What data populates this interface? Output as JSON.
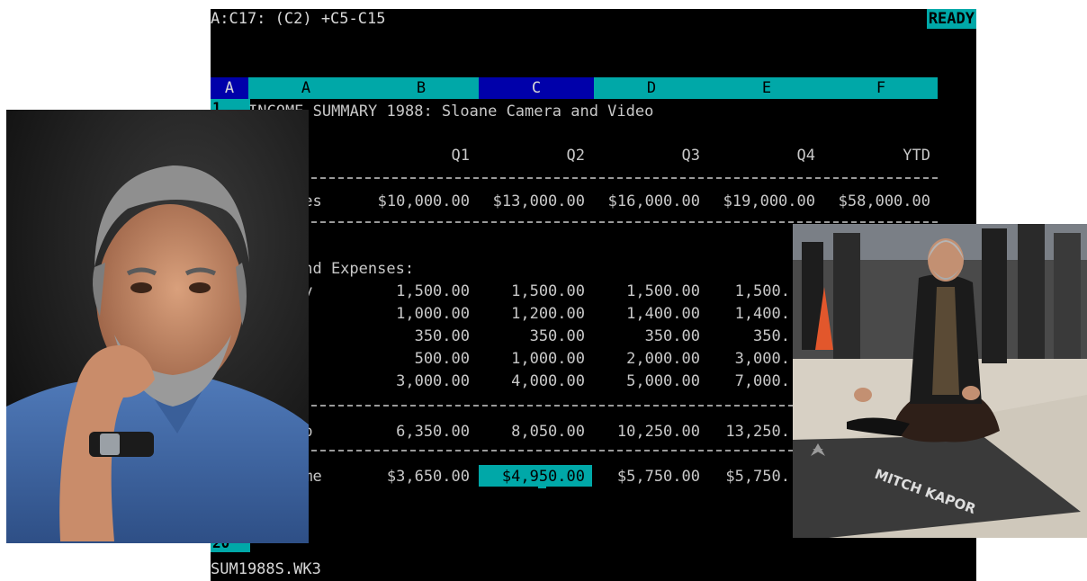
{
  "status": {
    "cell_ref": "A:C17: (C2) +C5-C15",
    "mode": "READY"
  },
  "col_headers": {
    "corner": "A",
    "a": "A",
    "b": "B",
    "c": "C",
    "d": "D",
    "e": "E",
    "f": "F"
  },
  "row_numbers": {
    "first": "1",
    "last": "20"
  },
  "sheet": {
    "title": "INCOME SUMMARY 1988: Sloane Camera and Video",
    "quarters": [
      "Q1",
      "Q2",
      "Q3",
      "Q4",
      "YTD"
    ],
    "sales": {
      "label": "les",
      "values": [
        "$10,000.00",
        "$13,000.00",
        "$16,000.00",
        "$19,000.00",
        "$58,000.00"
      ]
    },
    "expenses_heading": "and Expenses:",
    "expense_rows": [
      {
        "label": "ry",
        "values": [
          "1,500.00",
          "1,500.00",
          "1,500.00",
          "1,500."
        ]
      },
      {
        "label": "",
        "values": [
          "1,000.00",
          "1,200.00",
          "1,400.00",
          "1,400."
        ]
      },
      {
        "label": "",
        "values": [
          "350.00",
          "350.00",
          "350.00",
          "350."
        ]
      },
      {
        "label": "",
        "values": [
          "500.00",
          "1,000.00",
          "2,000.00",
          "3,000."
        ]
      },
      {
        "label": "",
        "values": [
          "3,000.00",
          "4,000.00",
          "5,000.00",
          "7,000."
        ]
      }
    ],
    "total": {
      "label": "xp",
      "values": [
        "6,350.00",
        "8,050.00",
        "10,250.00",
        "13,250."
      ]
    },
    "net": {
      "label": "ome",
      "values": [
        "$3,650.00",
        "$4,950.00",
        "$5,750.00",
        "$5,750."
      ]
    }
  },
  "filename": "SUM1988S.WK3",
  "photo2_caption": "MITCH KAPOR",
  "colors": {
    "cyan": "#00a8a8",
    "blue": "#0000aa",
    "screen": "#000000"
  }
}
